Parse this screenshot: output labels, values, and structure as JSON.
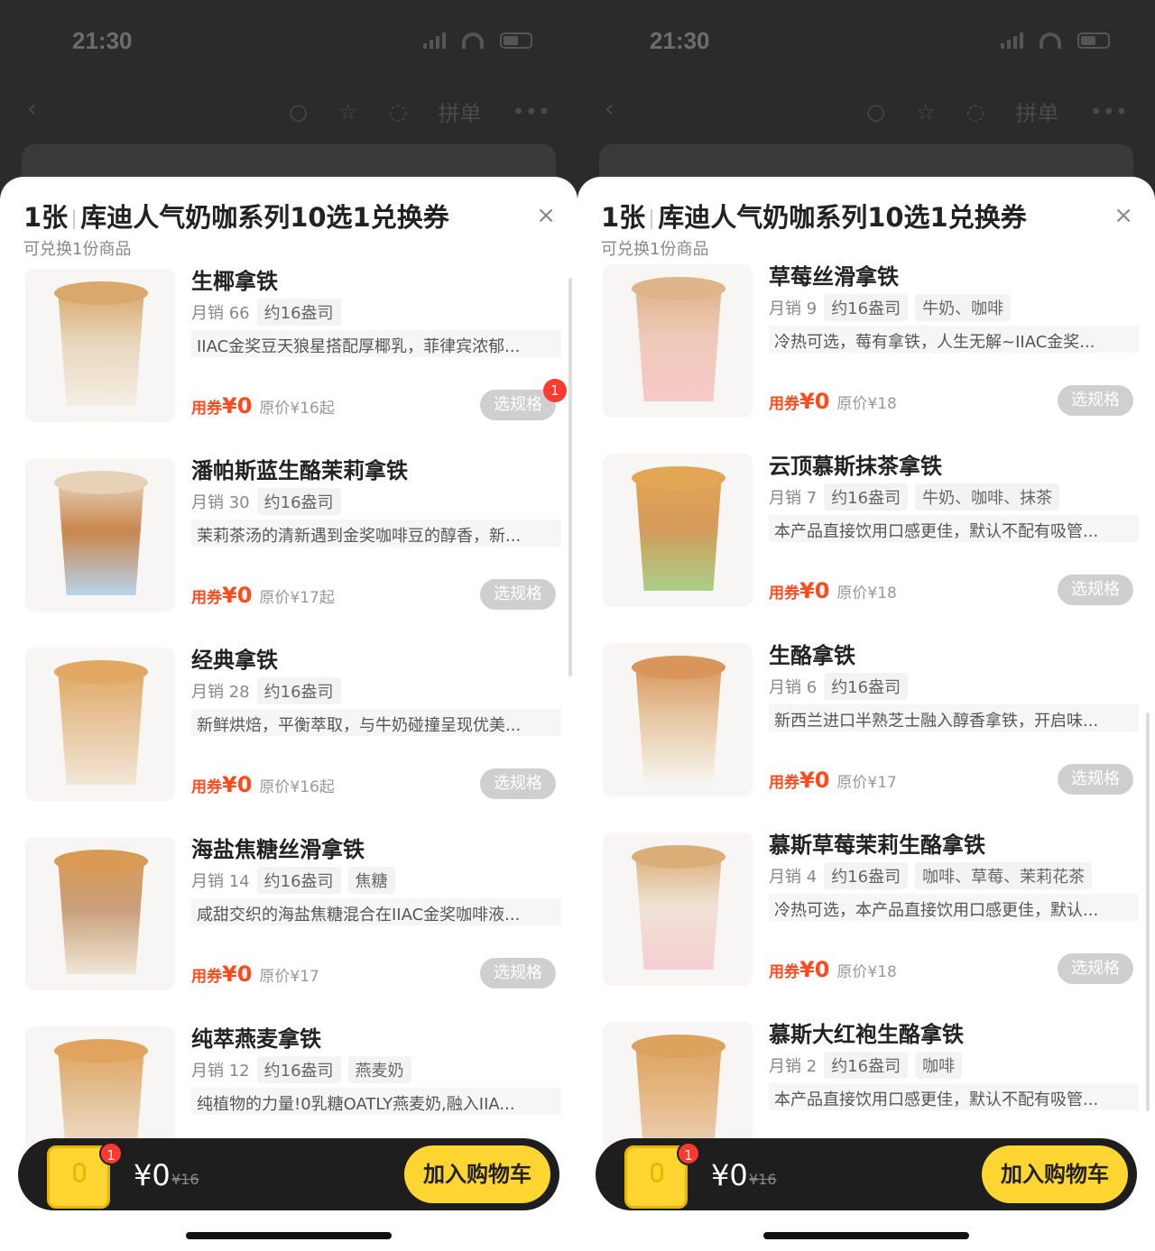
{
  "panels": [
    {
      "status_time": "21:30",
      "nav_pin": "拼单",
      "sheet_title_count": "1张",
      "sheet_title": "库迪人气奶咖系列10选1兑换券",
      "sheet_subtitle": "可兑换1份商品",
      "close": "×",
      "coupon_label": "用券",
      "zero_price": "¥0",
      "spec_button": "选规格",
      "items": [
        {
          "name": "生椰拿铁",
          "sales": "月销 66",
          "tags": [
            "约16盎司"
          ],
          "desc": "IIAC金奖豆天狼星搭配厚椰乳，菲律宾浓郁...",
          "orig": "原价¥16起",
          "badge": "1",
          "colors": {
            "top": "#d9a86a",
            "body": "#e8d6bb",
            "bottom": "#f4eee4"
          }
        },
        {
          "name": "潘帕斯蓝生酪茉莉拿铁",
          "sales": "月销 30",
          "tags": [
            "约16盎司"
          ],
          "desc": "茉莉茶汤的清新遇到金奖咖啡豆的醇香，新...",
          "orig": "原价¥17起",
          "badge": "",
          "colors": {
            "top": "#e7d1b7",
            "body": "#c9874e",
            "bottom": "#b7d4ea"
          }
        },
        {
          "name": "经典拿铁",
          "sales": "月销 28",
          "tags": [
            "约16盎司"
          ],
          "desc": "新鲜烘焙，平衡萃取，与牛奶碰撞呈现优美...",
          "orig": "原价¥16起",
          "badge": "",
          "colors": {
            "top": "#e0a862",
            "body": "#e7c49a",
            "bottom": "#f1e6d6"
          }
        },
        {
          "name": "海盐焦糖丝滑拿铁",
          "sales": "月销 14",
          "tags": [
            "约16盎司",
            "焦糖"
          ],
          "desc": "咸甜交织的海盐焦糖混合在IIAC金奖咖啡液...",
          "orig": "原价¥17",
          "badge": "",
          "colors": {
            "top": "#d99a56",
            "body": "#caa07a",
            "bottom": "#efe6d8"
          }
        },
        {
          "name": "纯萃燕麦拿铁",
          "sales": "月销 12",
          "tags": [
            "约16盎司",
            "燕麦奶"
          ],
          "desc": "纯植物的力量!0乳糖OATLY燕麦奶,融入IIA...",
          "orig": "",
          "badge": "",
          "colors": {
            "top": "#e0a45e",
            "body": "#e4c29a",
            "bottom": "#f1e6d6"
          }
        }
      ],
      "cart": {
        "badge": "1",
        "price": "¥0",
        "orig": "¥16",
        "button": "加入购物车"
      }
    },
    {
      "status_time": "21:30",
      "nav_pin": "拼单",
      "sheet_title_count": "1张",
      "sheet_title": "库迪人气奶咖系列10选1兑换券",
      "sheet_subtitle": "可兑换1份商品",
      "close": "×",
      "coupon_label": "用券",
      "zero_price": "¥0",
      "spec_button": "选规格",
      "items": [
        {
          "name": "草莓丝滑拿铁",
          "sales": "月销 9",
          "tags": [
            "约16盎司",
            "牛奶、咖啡"
          ],
          "desc": "冷热可选，莓有拿铁，人生无解~IIAC金奖...",
          "orig": "原价¥18",
          "badge": "",
          "colors": {
            "top": "#deb48a",
            "body": "#efc9b8",
            "bottom": "#f6c9c9"
          }
        },
        {
          "name": "云顶慕斯抹茶拿铁",
          "sales": "月销 7",
          "tags": [
            "约16盎司",
            "牛奶、咖啡、抹茶"
          ],
          "desc": "本产品直接饮用口感更佳，默认不配有吸管...",
          "orig": "原价¥18",
          "badge": "",
          "colors": {
            "top": "#e2a655",
            "body": "#d69a5a",
            "bottom": "#a9cf86"
          }
        },
        {
          "name": "生酪拿铁",
          "sales": "月销 6",
          "tags": [
            "约16盎司"
          ],
          "desc": "新西兰进口半熟芝士融入醇香拿铁，开启味...",
          "orig": "原价¥17",
          "badge": "",
          "colors": {
            "top": "#d9955a",
            "body": "#e6c6a0",
            "bottom": "#f6f2ec"
          }
        },
        {
          "name": "慕斯草莓茉莉生酪拿铁",
          "sales": "月销 4",
          "tags": [
            "约16盎司",
            "咖啡、草莓、茉莉花茶"
          ],
          "desc": "冷热可选，本产品直接饮用口感更佳，默认...",
          "orig": "原价¥18",
          "badge": "",
          "colors": {
            "top": "#dcae77",
            "body": "#f0e2d4",
            "bottom": "#f5cfd2"
          }
        },
        {
          "name": "慕斯大红袍生酪拿铁",
          "sales": "月销 2",
          "tags": [
            "约16盎司",
            "咖啡"
          ],
          "desc": "本产品直接饮用口感更佳，默认不配有吸管...",
          "orig": "",
          "badge": "",
          "colors": {
            "top": "#dba25e",
            "body": "#e5b783",
            "bottom": "#ead5bd"
          }
        }
      ],
      "cart": {
        "badge": "1",
        "price": "¥0",
        "orig": "¥16",
        "button": "加入购物车"
      }
    }
  ]
}
